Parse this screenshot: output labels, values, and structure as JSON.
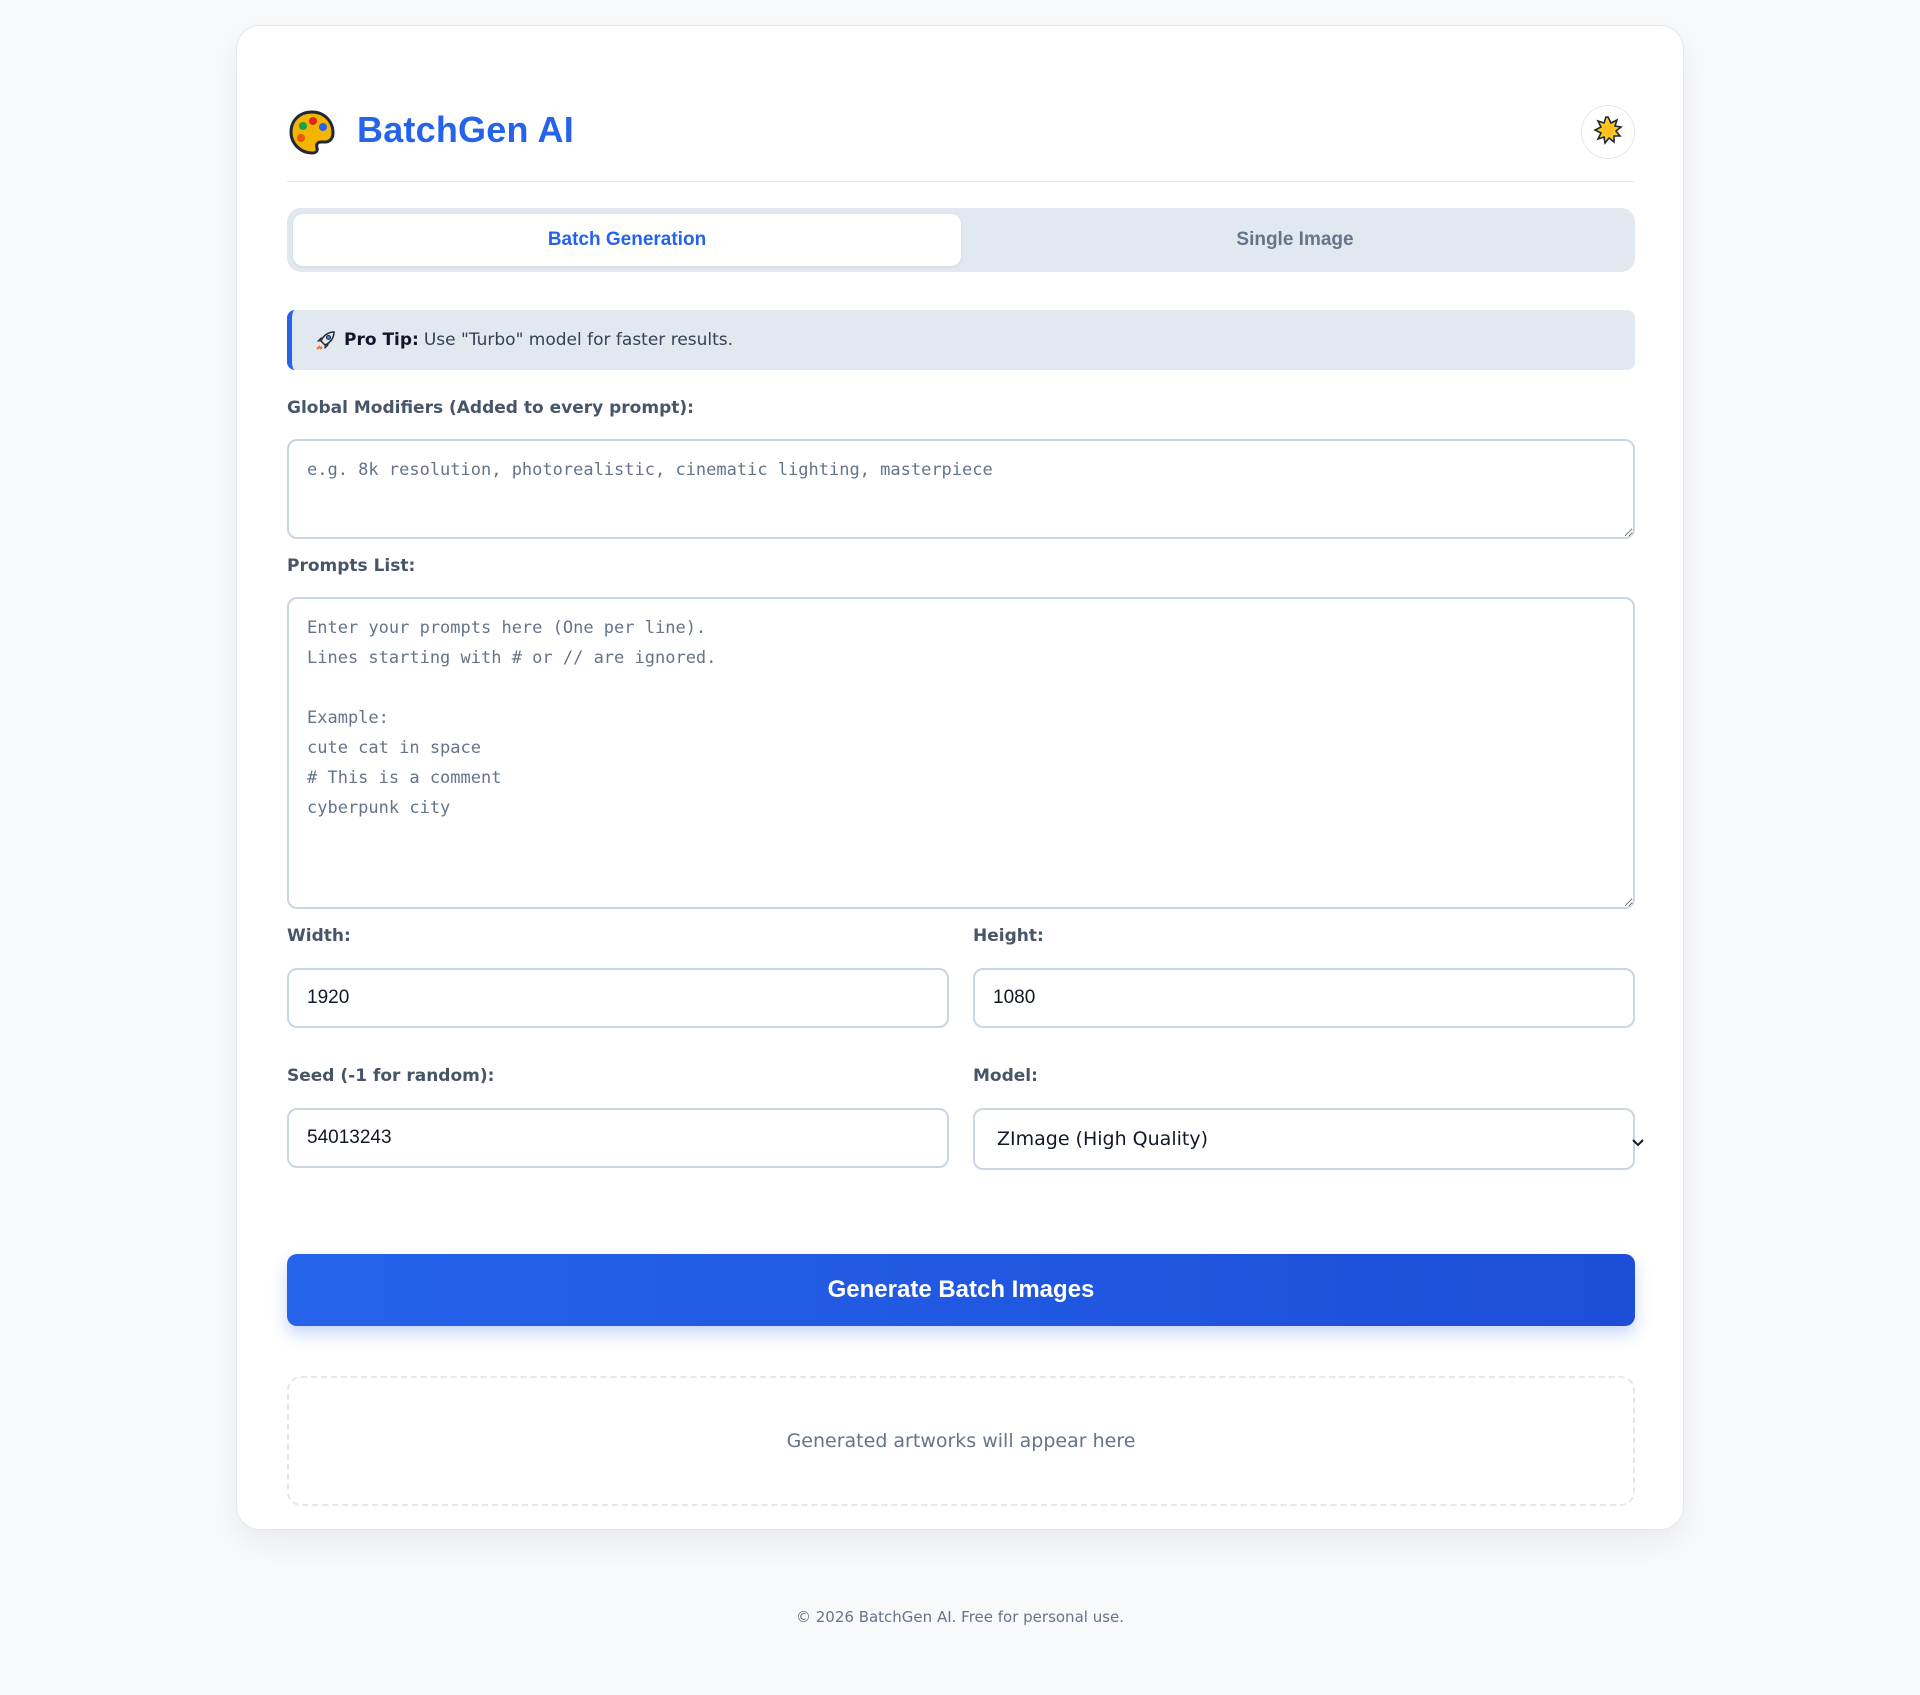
{
  "header": {
    "title": "BatchGen AI",
    "logo_icon": "palette-icon",
    "theme_toggle_icon": "sun-icon"
  },
  "tabs": [
    {
      "label": "Batch Generation",
      "active": true
    },
    {
      "label": "Single Image",
      "active": false
    }
  ],
  "tip": {
    "icon": "rocket-icon",
    "bold": "Pro Tip:",
    "text": "Use \"Turbo\" model for faster results."
  },
  "global_modifiers": {
    "label": "Global Modifiers (Added to every prompt):",
    "placeholder": "e.g. 8k resolution, photorealistic, cinematic lighting, masterpiece",
    "value": ""
  },
  "prompts": {
    "label": "Prompts List:",
    "placeholder": "Enter your prompts here (One per line).\nLines starting with # or // are ignored.\n\nExample:\ncute cat in space\n# This is a comment\ncyberpunk city",
    "value": ""
  },
  "width": {
    "label": "Width:",
    "value": "1920"
  },
  "height": {
    "label": "Height:",
    "value": "1080"
  },
  "seed": {
    "label": "Seed (-1 for random):",
    "value": "54013243"
  },
  "model": {
    "label": "Model:",
    "selected": "ZImage (High Quality)"
  },
  "generate_button": "Generate Batch Images",
  "results_placeholder": "Generated artworks will appear here",
  "footer": "© 2026 BatchGen AI. Free for personal use.",
  "colors": {
    "accent": "#2563eb",
    "background": "#f8f9fb",
    "card": "#ffffff",
    "tab_bar": "#e2e8f0"
  }
}
